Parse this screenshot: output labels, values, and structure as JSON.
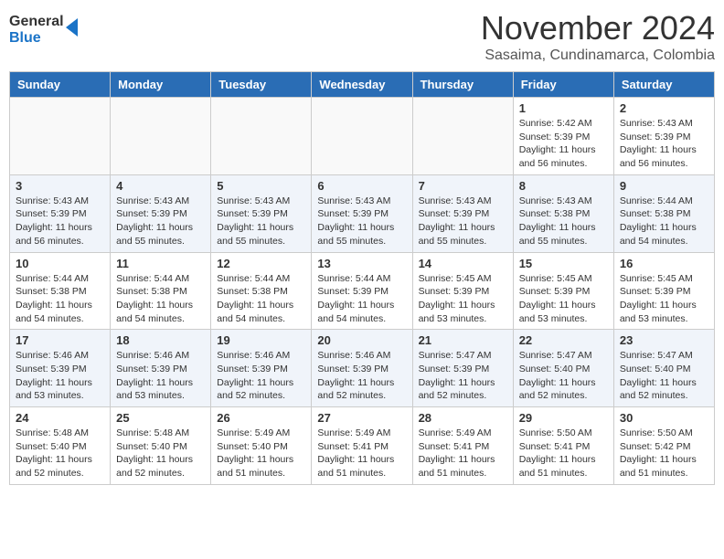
{
  "header": {
    "logo_line1": "General",
    "logo_line2": "Blue",
    "month": "November 2024",
    "location": "Sasaima, Cundinamarca, Colombia"
  },
  "weekdays": [
    "Sunday",
    "Monday",
    "Tuesday",
    "Wednesday",
    "Thursday",
    "Friday",
    "Saturday"
  ],
  "weeks": [
    [
      {
        "day": "",
        "info": ""
      },
      {
        "day": "",
        "info": ""
      },
      {
        "day": "",
        "info": ""
      },
      {
        "day": "",
        "info": ""
      },
      {
        "day": "",
        "info": ""
      },
      {
        "day": "1",
        "info": "Sunrise: 5:42 AM\nSunset: 5:39 PM\nDaylight: 11 hours\nand 56 minutes."
      },
      {
        "day": "2",
        "info": "Sunrise: 5:43 AM\nSunset: 5:39 PM\nDaylight: 11 hours\nand 56 minutes."
      }
    ],
    [
      {
        "day": "3",
        "info": "Sunrise: 5:43 AM\nSunset: 5:39 PM\nDaylight: 11 hours\nand 56 minutes."
      },
      {
        "day": "4",
        "info": "Sunrise: 5:43 AM\nSunset: 5:39 PM\nDaylight: 11 hours\nand 55 minutes."
      },
      {
        "day": "5",
        "info": "Sunrise: 5:43 AM\nSunset: 5:39 PM\nDaylight: 11 hours\nand 55 minutes."
      },
      {
        "day": "6",
        "info": "Sunrise: 5:43 AM\nSunset: 5:39 PM\nDaylight: 11 hours\nand 55 minutes."
      },
      {
        "day": "7",
        "info": "Sunrise: 5:43 AM\nSunset: 5:39 PM\nDaylight: 11 hours\nand 55 minutes."
      },
      {
        "day": "8",
        "info": "Sunrise: 5:43 AM\nSunset: 5:38 PM\nDaylight: 11 hours\nand 55 minutes."
      },
      {
        "day": "9",
        "info": "Sunrise: 5:44 AM\nSunset: 5:38 PM\nDaylight: 11 hours\nand 54 minutes."
      }
    ],
    [
      {
        "day": "10",
        "info": "Sunrise: 5:44 AM\nSunset: 5:38 PM\nDaylight: 11 hours\nand 54 minutes."
      },
      {
        "day": "11",
        "info": "Sunrise: 5:44 AM\nSunset: 5:38 PM\nDaylight: 11 hours\nand 54 minutes."
      },
      {
        "day": "12",
        "info": "Sunrise: 5:44 AM\nSunset: 5:38 PM\nDaylight: 11 hours\nand 54 minutes."
      },
      {
        "day": "13",
        "info": "Sunrise: 5:44 AM\nSunset: 5:39 PM\nDaylight: 11 hours\nand 54 minutes."
      },
      {
        "day": "14",
        "info": "Sunrise: 5:45 AM\nSunset: 5:39 PM\nDaylight: 11 hours\nand 53 minutes."
      },
      {
        "day": "15",
        "info": "Sunrise: 5:45 AM\nSunset: 5:39 PM\nDaylight: 11 hours\nand 53 minutes."
      },
      {
        "day": "16",
        "info": "Sunrise: 5:45 AM\nSunset: 5:39 PM\nDaylight: 11 hours\nand 53 minutes."
      }
    ],
    [
      {
        "day": "17",
        "info": "Sunrise: 5:46 AM\nSunset: 5:39 PM\nDaylight: 11 hours\nand 53 minutes."
      },
      {
        "day": "18",
        "info": "Sunrise: 5:46 AM\nSunset: 5:39 PM\nDaylight: 11 hours\nand 53 minutes."
      },
      {
        "day": "19",
        "info": "Sunrise: 5:46 AM\nSunset: 5:39 PM\nDaylight: 11 hours\nand 52 minutes."
      },
      {
        "day": "20",
        "info": "Sunrise: 5:46 AM\nSunset: 5:39 PM\nDaylight: 11 hours\nand 52 minutes."
      },
      {
        "day": "21",
        "info": "Sunrise: 5:47 AM\nSunset: 5:39 PM\nDaylight: 11 hours\nand 52 minutes."
      },
      {
        "day": "22",
        "info": "Sunrise: 5:47 AM\nSunset: 5:40 PM\nDaylight: 11 hours\nand 52 minutes."
      },
      {
        "day": "23",
        "info": "Sunrise: 5:47 AM\nSunset: 5:40 PM\nDaylight: 11 hours\nand 52 minutes."
      }
    ],
    [
      {
        "day": "24",
        "info": "Sunrise: 5:48 AM\nSunset: 5:40 PM\nDaylight: 11 hours\nand 52 minutes."
      },
      {
        "day": "25",
        "info": "Sunrise: 5:48 AM\nSunset: 5:40 PM\nDaylight: 11 hours\nand 52 minutes."
      },
      {
        "day": "26",
        "info": "Sunrise: 5:49 AM\nSunset: 5:40 PM\nDaylight: 11 hours\nand 51 minutes."
      },
      {
        "day": "27",
        "info": "Sunrise: 5:49 AM\nSunset: 5:41 PM\nDaylight: 11 hours\nand 51 minutes."
      },
      {
        "day": "28",
        "info": "Sunrise: 5:49 AM\nSunset: 5:41 PM\nDaylight: 11 hours\nand 51 minutes."
      },
      {
        "day": "29",
        "info": "Sunrise: 5:50 AM\nSunset: 5:41 PM\nDaylight: 11 hours\nand 51 minutes."
      },
      {
        "day": "30",
        "info": "Sunrise: 5:50 AM\nSunset: 5:42 PM\nDaylight: 11 hours\nand 51 minutes."
      }
    ]
  ]
}
